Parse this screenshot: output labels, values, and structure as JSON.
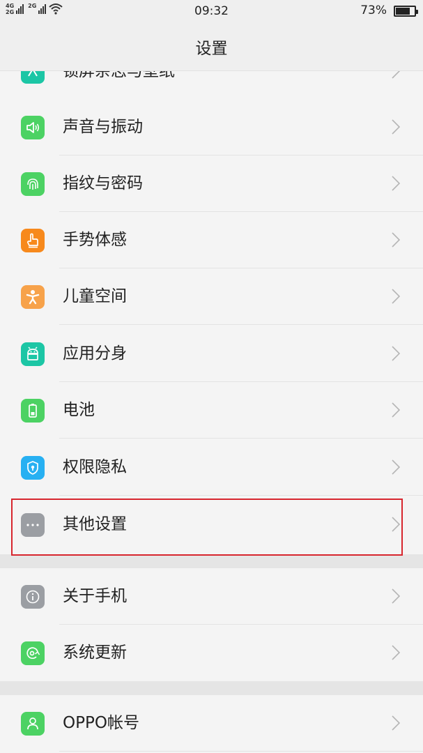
{
  "status": {
    "network_top": "4G",
    "network_bottom": "2G",
    "network_second": "2G",
    "time": "09:32",
    "battery": "73%",
    "battery_level": 0.73
  },
  "header": {
    "title": "设置"
  },
  "settings": [
    {
      "label": "锁屏杂志与壁纸",
      "icon": "wallpaper-icon",
      "color": "#1cc6a5"
    },
    {
      "label": "声音与振动",
      "icon": "speaker-icon",
      "color": "#4cd263"
    },
    {
      "label": "指纹与密码",
      "icon": "fingerprint-icon",
      "color": "#4cd263"
    },
    {
      "label": "手势体感",
      "icon": "gesture-icon",
      "color": "#f7891c"
    },
    {
      "label": "儿童空间",
      "icon": "child-icon",
      "color": "#f7a24a"
    },
    {
      "label": "应用分身",
      "icon": "android-icon",
      "color": "#1cc6a5"
    },
    {
      "label": "电池",
      "icon": "battery-icon",
      "color": "#4cd263"
    },
    {
      "label": "权限隐私",
      "icon": "privacy-shield-icon",
      "color": "#27b0f2"
    },
    {
      "label": "其他设置",
      "icon": "more-dots-icon",
      "color": "#9b9ea3"
    },
    {
      "label": "关于手机",
      "icon": "info-icon",
      "color": "#9b9ea3"
    },
    {
      "label": "系统更新",
      "icon": "system-update-icon",
      "color": "#4cd263"
    },
    {
      "label": "OPPO帐号",
      "icon": "account-icon",
      "color": "#4cd263"
    }
  ]
}
